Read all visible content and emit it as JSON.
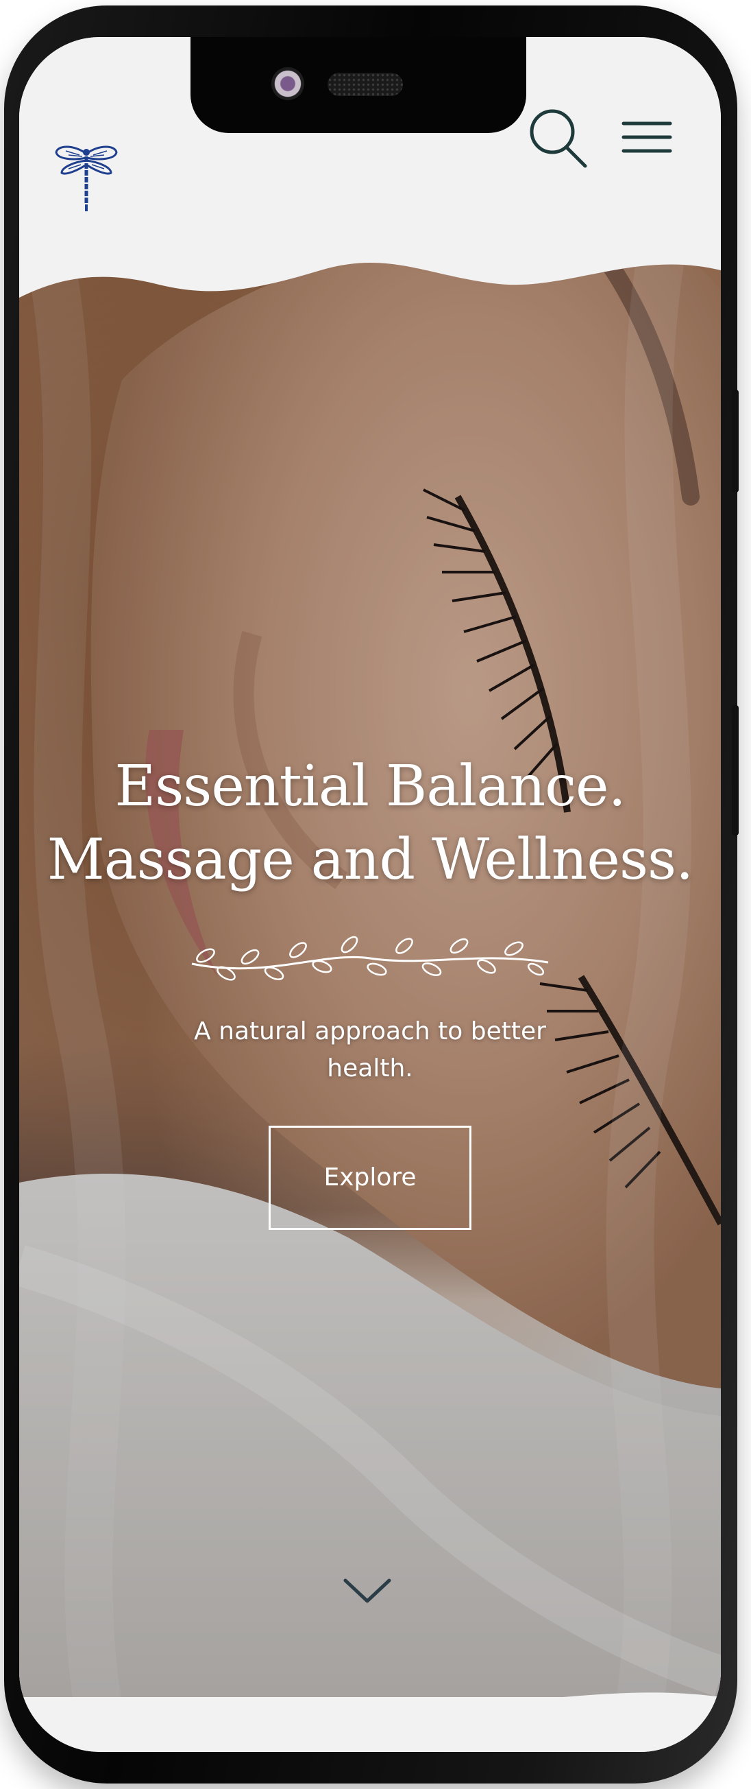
{
  "header": {
    "logo_icon": "dragonfly-icon",
    "search_icon": "search-icon",
    "menu_icon": "hamburger-menu-icon"
  },
  "hero": {
    "headline_line1": "Essential Balance.",
    "headline_line2": "Massage and Wellness.",
    "tagline": "A natural approach to better health.",
    "cta_label": "Explore",
    "scroll_icon": "chevron-down-icon"
  },
  "colors": {
    "logo": "#1f3f8f",
    "icons": "#1f3a3a",
    "hero_text": "#ffffff",
    "header_bg": "#f2f2f2"
  }
}
